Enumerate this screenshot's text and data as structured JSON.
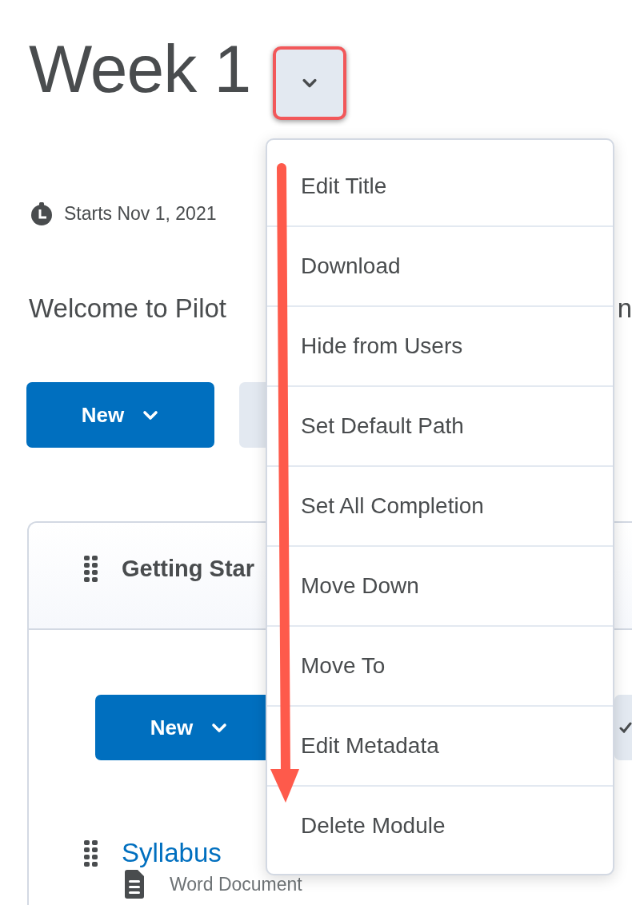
{
  "page": {
    "title": "Week 1",
    "start_date": "Starts Nov 1, 2021",
    "description": "Welcome to Pilot",
    "description_tail": "n"
  },
  "toolbar": {
    "new_button": "New"
  },
  "module": {
    "title": "Getting Star",
    "new_button": "New",
    "items": [
      {
        "title": "Syllabus",
        "type": "Word Document"
      }
    ]
  },
  "menu": {
    "items": [
      {
        "label": "Edit Title"
      },
      {
        "label": "Download"
      },
      {
        "label": "Hide from Users"
      },
      {
        "label": "Set Default Path"
      },
      {
        "label": "Set All Completion"
      },
      {
        "label": "Move Down"
      },
      {
        "label": "Move To"
      },
      {
        "label": "Edit Metadata"
      },
      {
        "label": "Delete Module"
      }
    ]
  }
}
